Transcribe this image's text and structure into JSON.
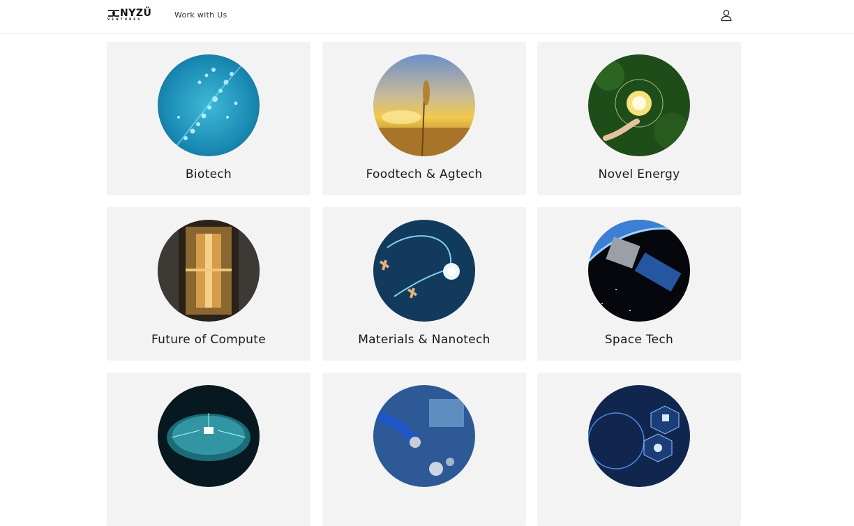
{
  "brand": {
    "name": "NYZÜ",
    "sub": "VENTURES",
    "logo_icon": "infinity-mark-icon"
  },
  "nav": {
    "work_with_us": "Work with Us",
    "account_icon": "user-icon"
  },
  "categories": [
    {
      "title": "Biotech",
      "image": "dna-helix-image"
    },
    {
      "title": "Foodtech & Agtech",
      "image": "wheat-sunset-image"
    },
    {
      "title": "Novel Energy",
      "image": "green-lightbulb-image"
    },
    {
      "title": "Future of Compute",
      "image": "quantum-computer-image"
    },
    {
      "title": "Materials & Nanotech",
      "image": "nano-robot-image"
    },
    {
      "title": "Space Tech",
      "image": "satellite-image"
    },
    {
      "title": "",
      "image": "circuit-brain-image"
    },
    {
      "title": "",
      "image": "robot-arm-image"
    },
    {
      "title": "",
      "image": "cyber-security-image"
    }
  ]
}
